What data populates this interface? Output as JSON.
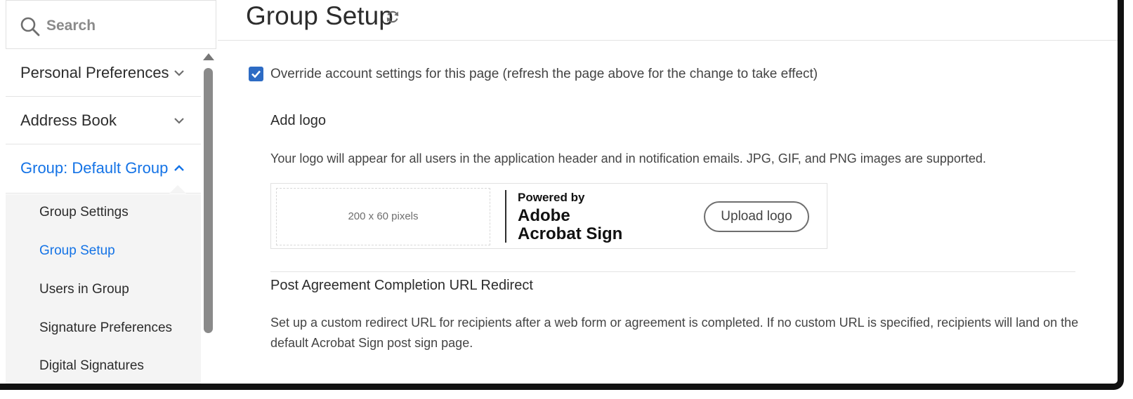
{
  "search": {
    "placeholder": "Search"
  },
  "sidebar": {
    "items": [
      {
        "label": "Personal Preferences"
      },
      {
        "label": "Address Book"
      },
      {
        "label": "Group: Default Group"
      }
    ],
    "subitems": [
      {
        "label": "Group Settings"
      },
      {
        "label": "Group Setup"
      },
      {
        "label": "Users in Group"
      },
      {
        "label": "Signature Preferences"
      },
      {
        "label": "Digital Signatures"
      }
    ],
    "active_subitem": "Group Setup"
  },
  "main": {
    "title": "Group Setup",
    "override": {
      "checked": true,
      "label": "Override account settings for this page (refresh the page above for the change to take effect)"
    },
    "logo_section": {
      "title": "Add logo",
      "description": "Your logo will appear for all users in the application header and in notification emails. JPG, GIF, and PNG images are supported.",
      "placeholder": "200 x 60 pixels",
      "powered_by": "Powered by",
      "brand_line1": "Adobe",
      "brand_line2": "Acrobat Sign",
      "upload_label": "Upload logo"
    },
    "redirect_section": {
      "title": "Post Agreement Completion URL Redirect",
      "description": "Set up a custom redirect URL for recipients after a web form or agreement is completed. If no custom URL is specified, recipients will land on the default Acrobat Sign post sign page."
    }
  },
  "colors": {
    "accent": "#1473e6",
    "checkbox": "#2d6bc4",
    "subnav_bg": "#f4f4f4"
  },
  "icons": [
    "search-icon",
    "chevron-down-icon",
    "chevron-up-icon",
    "refresh-icon",
    "checkmark-icon"
  ]
}
